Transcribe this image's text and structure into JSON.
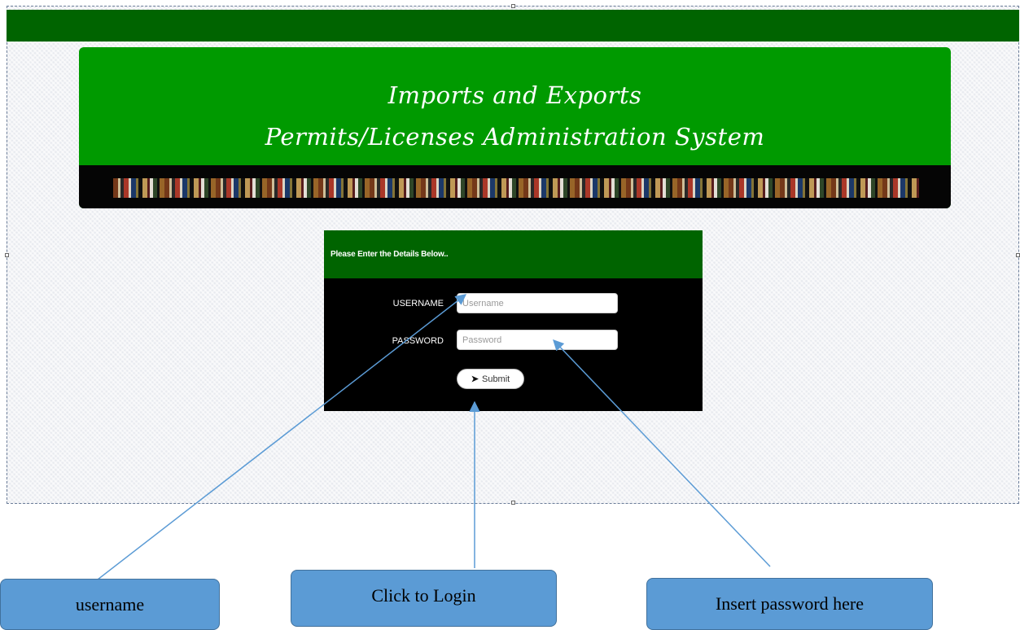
{
  "header": {
    "title_line1": "Imports and Exports",
    "title_line2": "Permits/Licenses Administration System"
  },
  "login": {
    "heading": "Please Enter the Details Below..",
    "username_label": "USERNAME",
    "username_placeholder": "Username",
    "password_label": "PASSWORD",
    "password_placeholder": "Password",
    "submit_label": "Submit"
  },
  "callouts": {
    "username": "username",
    "login": "Click to Login",
    "password": "Insert password here"
  },
  "colors": {
    "topbar": "#006400",
    "banner": "#009a00",
    "panel": "#000000",
    "callout": "#5b9bd5",
    "arrow": "#5b9bd5"
  }
}
